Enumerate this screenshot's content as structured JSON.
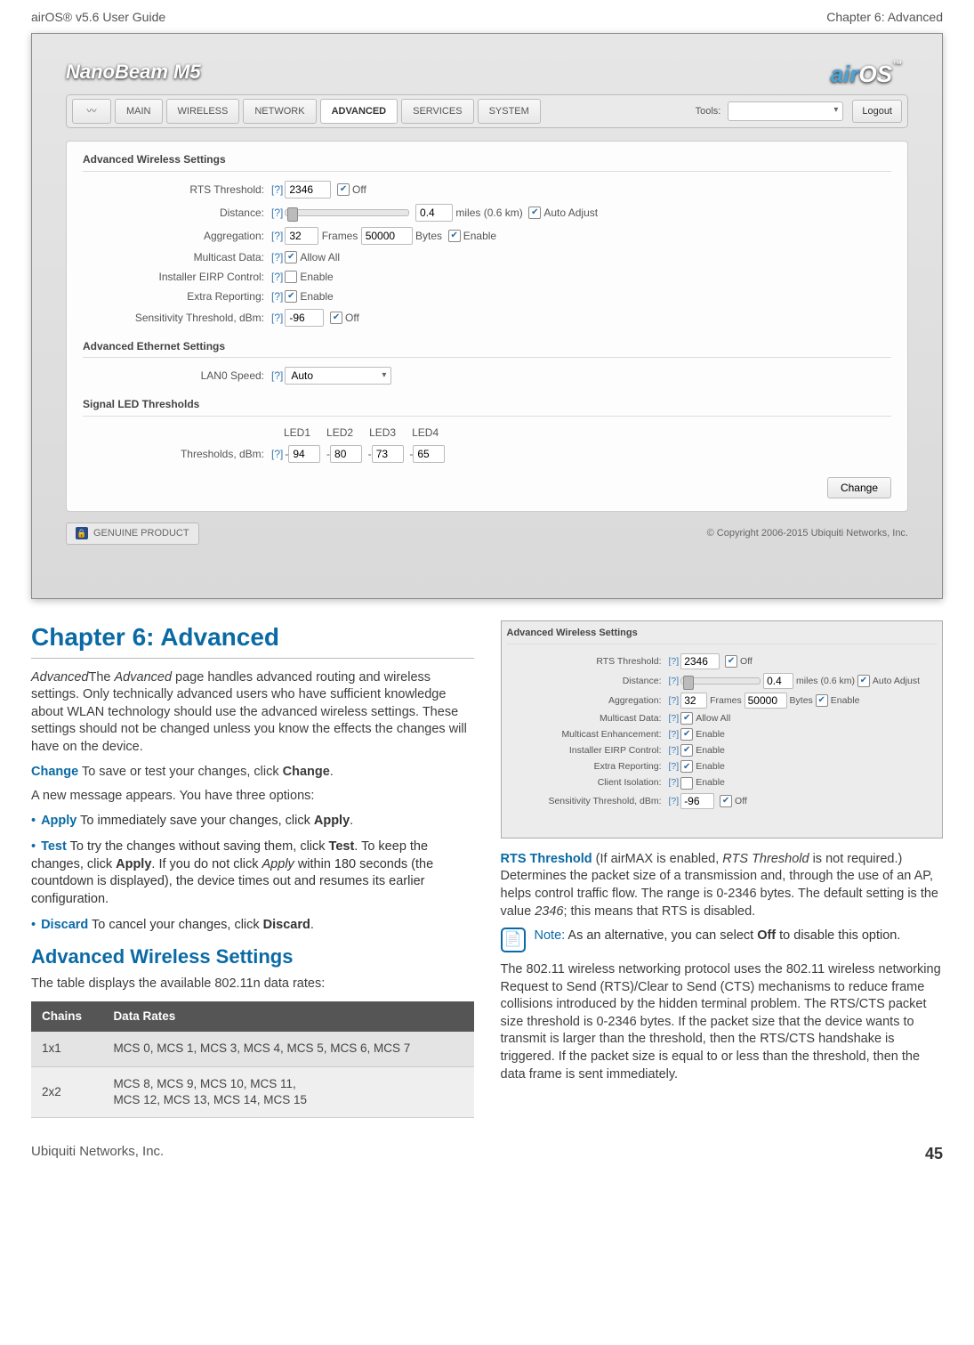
{
  "header": {
    "left": "airOS® v5.6 User Guide",
    "right": "Chapter 6: Advanced"
  },
  "footer": {
    "left": "Ubiquiti Networks, Inc.",
    "right": "45"
  },
  "screenshot": {
    "device_brand": "NanoBeam M5",
    "os_brand_prefix": "air",
    "os_brand_suffix": "OS",
    "os_tm": "™",
    "tabs": [
      "MAIN",
      "WIRELESS",
      "NETWORK",
      "ADVANCED",
      "SERVICES",
      "SYSTEM"
    ],
    "active_tab": "ADVANCED",
    "tools_label": "Tools:",
    "logout": "Logout",
    "panels": {
      "wireless_title": "Advanced Wireless Settings",
      "ethernet_title": "Advanced Ethernet Settings",
      "signal_title": "Signal LED Thresholds"
    },
    "wireless": {
      "rts_label": "RTS Threshold:",
      "rts_value": "2346",
      "rts_off": "Off",
      "distance_label": "Distance:",
      "distance_value": "0.4",
      "distance_unit": "miles (0.6 km)",
      "auto_adjust": "Auto Adjust",
      "aggregation_label": "Aggregation:",
      "agg_frames": "32",
      "frames_word": "Frames",
      "agg_bytes": "50000",
      "bytes_word": "Bytes",
      "enable_word": "Enable",
      "multicast_label": "Multicast Data:",
      "allow_all": "Allow All",
      "eirp_label": "Installer EIRP Control:",
      "extra_label": "Extra Reporting:",
      "sens_label": "Sensitivity Threshold, dBm:",
      "sens_value": "-96",
      "off_word": "Off"
    },
    "ethernet": {
      "lan_label": "LAN0 Speed:",
      "lan_value": "Auto"
    },
    "leds": {
      "headers": [
        "LED1",
        "LED2",
        "LED3",
        "LED4"
      ],
      "row_label": "Thresholds, dBm:",
      "values": [
        "94",
        "80",
        "73",
        "65"
      ]
    },
    "change_btn": "Change",
    "genuine": "GENUINE         PRODUCT",
    "copyright": "© Copyright 2006-2015 Ubiquiti Networks, Inc."
  },
  "mini": {
    "title": "Advanced Wireless Settings",
    "multicast_enh_label": "Multicast Enhancement:",
    "client_iso_label": "Client Isolation:"
  },
  "chapter": {
    "title": "Chapter 6: Advanced",
    "intro": "The Advanced page handles advanced routing and wireless settings. Only technically advanced users who have sufficient knowledge about WLAN technology should use the advanced wireless settings. These settings should not be changed unless you know the effects the changes will have on the device.",
    "change_term": "Change",
    "change_body": "  To save or test your changes, click ",
    "change_bold": "Change",
    "new_msg": "A new message appears. You have three options:",
    "apply_term": "Apply",
    "apply_body": "   To immediately save your changes, click ",
    "apply_bold": "Apply",
    "test_term": "Test",
    "test_body1": "   To try the changes without saving them, click ",
    "test_bold1": "Test",
    "test_body2": ". To keep the changes, click ",
    "test_bold2": "Apply",
    "test_body3": ". If you do not click Apply within 180 seconds (the countdown is displayed), the device times out and resumes its earlier configuration.",
    "discard_term": "Discard",
    "discard_body": "  To cancel your changes, click ",
    "discard_bold": "Discard",
    "section_title": "Advanced Wireless Settings",
    "section_intro": "The table displays the available 802.11n data rates:"
  },
  "table": {
    "headers": [
      "Chains",
      "Data Rates"
    ],
    "rows": [
      [
        "1x1",
        "MCS 0, MCS 1, MCS 3, MCS 4, MCS 5, MCS 6, MCS 7"
      ],
      [
        "2x2",
        "MCS 8, MCS 9, MCS 10, MCS 11,\nMCS 12, MCS 13, MCS 14, MCS 15"
      ]
    ]
  },
  "right_col": {
    "rts_term": "RTS Threshold",
    "rts_body1": "  (If airMAX is enabled, RTS Threshold is not required.) Determines the packet size of a transmission and, through the use of an AP, helps control traffic flow. The range is 0-2346 bytes. The default setting is the value 2346; this means that RTS is disabled.",
    "note_label": "Note:",
    "note_body": " As an alternative, you can select Off to disable this option.",
    "para2": "The 802.11 wireless networking protocol uses the 802.11 wireless networking Request to Send (RTS)/Clear to Send (CTS) mechanisms to reduce frame collisions introduced by the hidden terminal problem. The RTS/CTS packet size threshold is 0-2346 bytes. If the packet size that the device wants to transmit is larger than the threshold, then the RTS/CTS handshake is triggered. If the packet size is equal to or less than the threshold, then the data frame is sent immediately."
  }
}
